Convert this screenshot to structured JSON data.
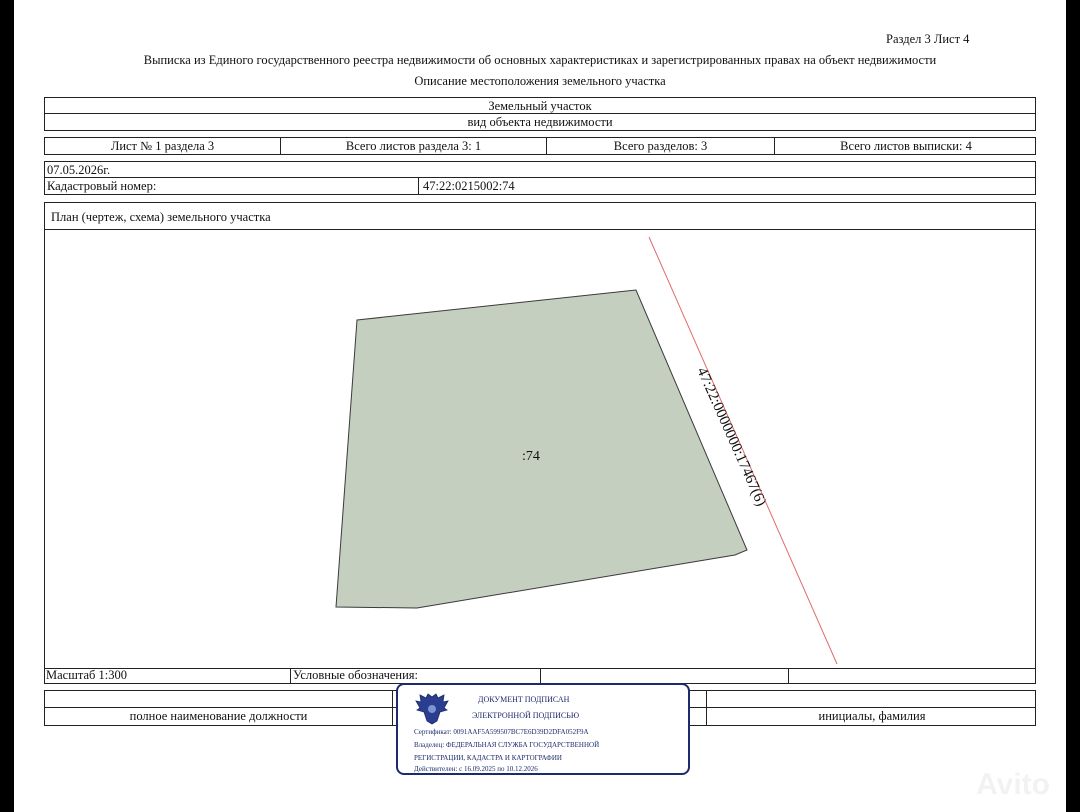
{
  "header": {
    "section_sheet": "Раздел 3   Лист 4",
    "title": "Выписка из Единого государственного реестра недвижимости об основных характеристиках и зарегистрированных правах на объект недвижимости",
    "subtitle": "Описание местоположения земельного участка"
  },
  "object": {
    "type": "Земельный участок",
    "type_caption": "вид объекта недвижимости"
  },
  "sheets": {
    "sheet": "Лист № 1 раздела 3",
    "total_sheets_section": "Всего листов раздела 3: 1",
    "total_sections": "Всего разделов: 3",
    "total_sheets": "Всего листов выписки: 4"
  },
  "date": "07.05.2026г.",
  "cadastral": {
    "label": "Кадастровый номер:",
    "value": "47:22:0215002:74"
  },
  "plan": {
    "title": "План (чертеж, схема) земельного участка",
    "parcel_label": ":74",
    "neighbor_label": "47:22:0000000:17467(6)"
  },
  "footer": {
    "scale": "Масштаб 1:300",
    "legend": "Условные обозначения:",
    "position_caption": "полное наименование должности",
    "name_caption": "инициалы, фамилия"
  },
  "stamp": {
    "line1": "ДОКУМЕНТ ПОДПИСАН",
    "line2": "ЭЛЕКТРОННОЙ ПОДПИСЬЮ",
    "certificate": "Сертификат: 0091AAF5A599507BC7E6D39D2DFA052F9A",
    "owner1": "Владелец: ФЕДЕРАЛЬНАЯ СЛУЖБА ГОСУДАРСТВЕННОЙ",
    "owner2": "РЕГИСТРАЦИИ, КАДАСТРА И КАРТОГРАФИИ",
    "valid": "Действителен: с 16.09.2025 по 10.12.2026"
  },
  "watermark": "Avito",
  "colors": {
    "parcel_fill": "#c4cfbf",
    "boundary_line": "#e06a6a",
    "stamp_blue": "#1d2a6b"
  }
}
